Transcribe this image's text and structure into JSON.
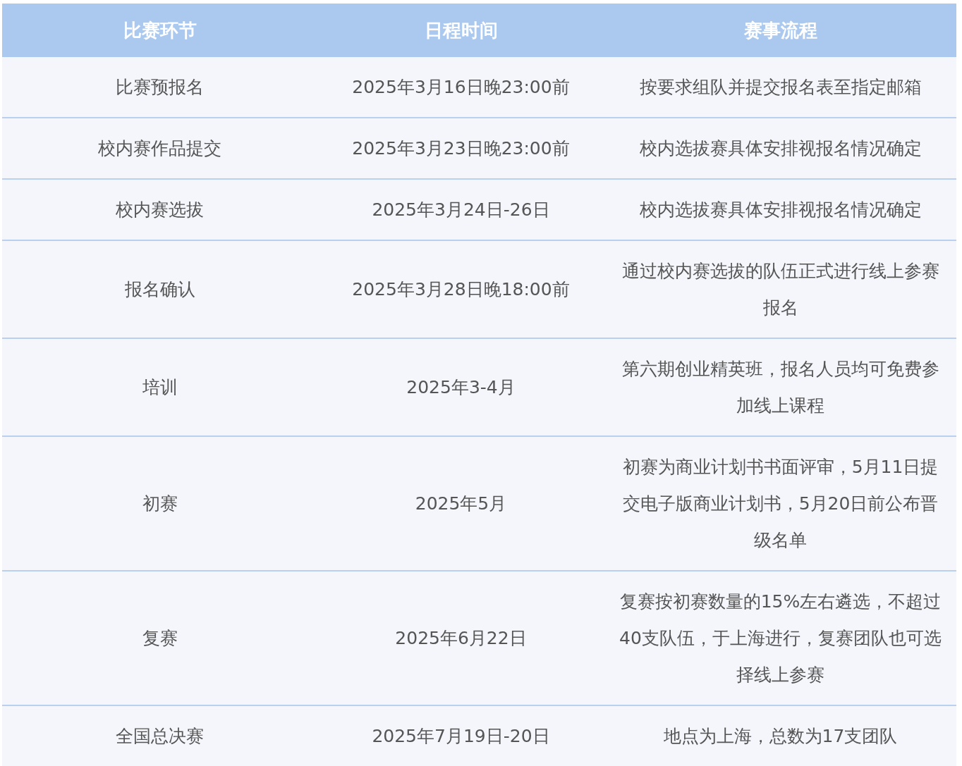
{
  "table": {
    "columns": [
      "比赛环节",
      "日程时间",
      "赛事流程"
    ],
    "rows": [
      [
        "比赛预报名",
        "2025年3月16日晚23:00前",
        "按要求组队并提交报名表至指定邮箱"
      ],
      [
        "校内赛作品提交",
        "2025年3月23日晚23:00前",
        "校内选拔赛具体安排视报名情况确定"
      ],
      [
        "校内赛选拔",
        "2025年3月24日-26日",
        "校内选拔赛具体安排视报名情况确定"
      ],
      [
        "报名确认",
        "2025年3月28日晚18:00前",
        "通过校内赛选拔的队伍正式进行线上参赛报名"
      ],
      [
        "培训",
        "2025年3-4月",
        "第六期创业精英班，报名人员均可免费参加线上课程"
      ],
      [
        "初赛",
        "2025年5月",
        "初赛为商业计划书书面评审，5月11日提交电子版商业计划书，5月20日前公布晋级名单"
      ],
      [
        "复赛",
        "2025年6月22日",
        "复赛按初赛数量的15%左右遴选，不超过40支队伍，于上海进行，复赛团队也可选择线上参赛"
      ],
      [
        "全国总决赛",
        "2025年7月19日-20日",
        "地点为上海，总数为17支团队"
      ]
    ]
  }
}
